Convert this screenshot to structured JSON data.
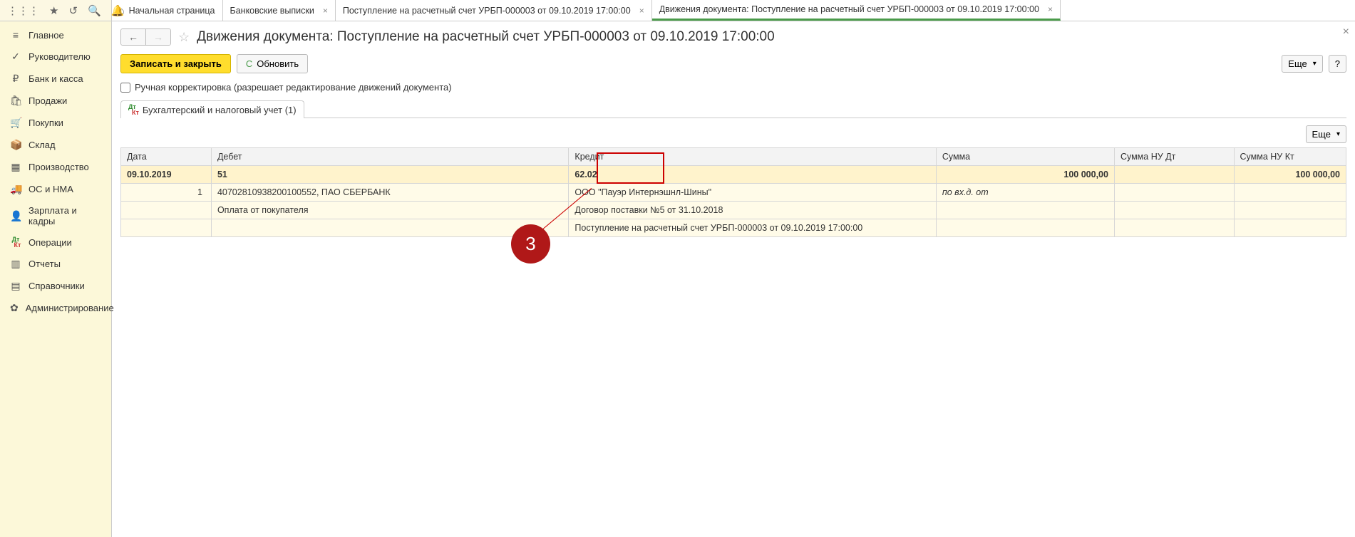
{
  "toolbar_icons": [
    "apps",
    "star",
    "history",
    "search",
    "bell"
  ],
  "tabs": [
    {
      "label": "Начальная страница",
      "home": true,
      "closable": false
    },
    {
      "label": "Банковские выписки",
      "closable": true
    },
    {
      "label": "Поступление на расчетный счет УРБП-000003 от 09.10.2019 17:00:00",
      "closable": true
    },
    {
      "label": "Движения документа: Поступление на расчетный счет УРБП-000003 от 09.10.2019 17:00:00",
      "closable": true,
      "active": true
    }
  ],
  "sidebar": [
    {
      "icon": "≡",
      "label": "Главное"
    },
    {
      "icon": "📈",
      "label": "Руководителю"
    },
    {
      "icon": "₽",
      "label": "Банк и касса"
    },
    {
      "icon": "🛍",
      "label": "Продажи"
    },
    {
      "icon": "🛒",
      "label": "Покупки"
    },
    {
      "icon": "📦",
      "label": "Склад"
    },
    {
      "icon": "🏭",
      "label": "Производство"
    },
    {
      "icon": "🚚",
      "label": "ОС и НМА"
    },
    {
      "icon": "👤",
      "label": "Зарплата и кадры"
    },
    {
      "icon": "DtKt",
      "label": "Операции"
    },
    {
      "icon": "📊",
      "label": "Отчеты"
    },
    {
      "icon": "📚",
      "label": "Справочники"
    },
    {
      "icon": "⚙",
      "label": "Администрирование"
    }
  ],
  "page": {
    "title": "Движения документа: Поступление на расчетный счет УРБП-000003 от 09.10.2019 17:00:00",
    "save_close": "Записать и закрыть",
    "refresh": "Обновить",
    "more": "Еще",
    "help": "?",
    "manual_edit": "Ручная корректировка (разрешает редактирование движений документа)",
    "tab_label": "Бухгалтерский и налоговый учет (1)"
  },
  "table": {
    "headers": {
      "date": "Дата",
      "debit": "Дебет",
      "credit": "Кредит",
      "sum": "Сумма",
      "nu_dt": "Сумма НУ Дт",
      "nu_kt": "Сумма НУ Кт"
    },
    "row_main": {
      "date": "09.10.2019",
      "debit": "51",
      "credit": "62.02",
      "sum": "100 000,00",
      "nu_kt": "100 000,00"
    },
    "row_sub": {
      "num": "1",
      "debit1": "40702810938200100552, ПАО СБЕРБАНК",
      "credit1": "ООО \"Пауэр Интернэшнл-Шины\"",
      "sum_note": "по вх.д.  от",
      "debit2": "Оплата от покупателя",
      "credit2": "Договор поставки №5 от 31.10.2018",
      "credit3": "Поступление на расчетный счет УРБП-000003 от 09.10.2019 17:00:00"
    }
  },
  "callout": {
    "number": "3"
  }
}
